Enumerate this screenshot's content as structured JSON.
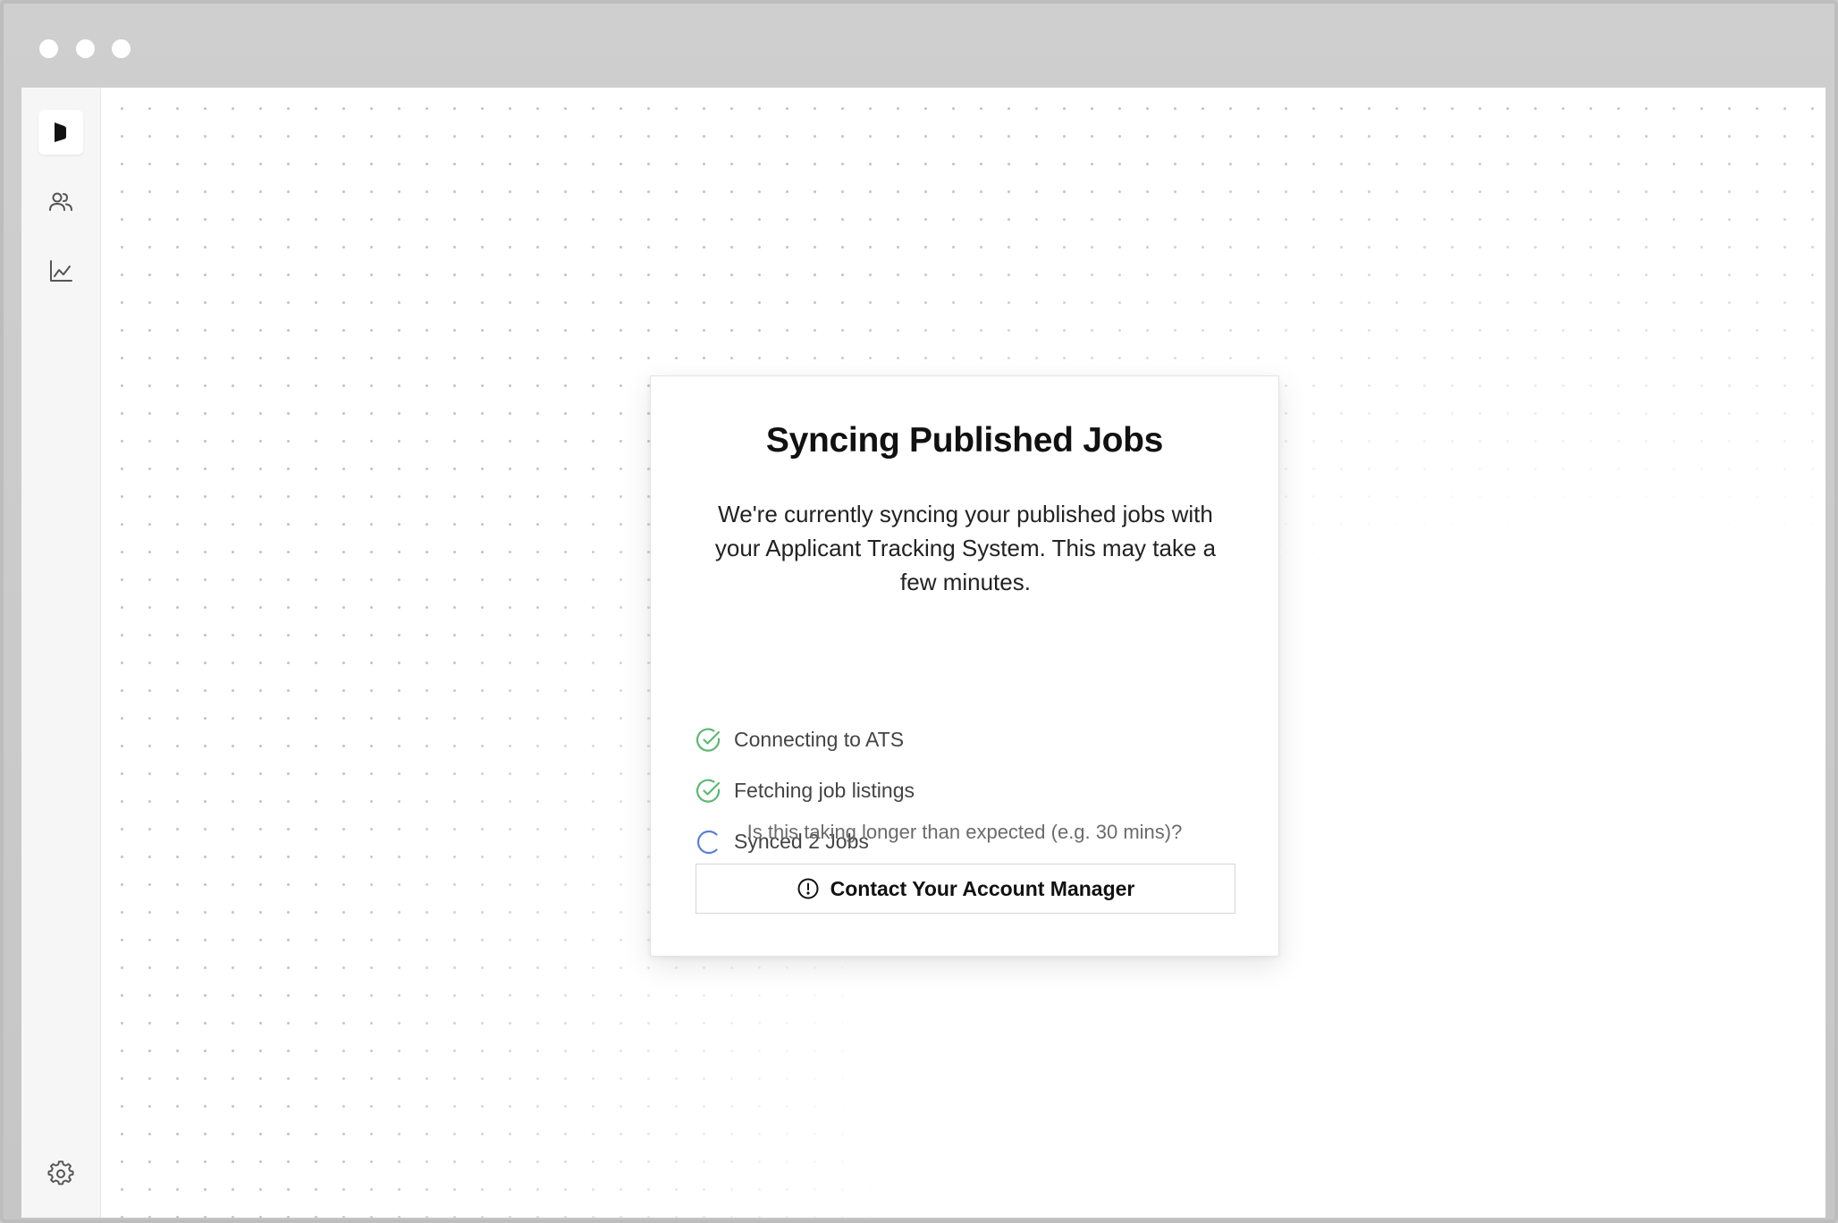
{
  "window": {
    "controls": [
      "close",
      "minimize",
      "zoom"
    ]
  },
  "sidebar": {
    "items": [
      {
        "id": "logo",
        "icon": "logo-icon"
      },
      {
        "id": "people",
        "icon": "users-icon"
      },
      {
        "id": "analytics",
        "icon": "chart-line-icon"
      }
    ],
    "footer_icon": "settings-gear-icon"
  },
  "sync_card": {
    "title": "Syncing Published Jobs",
    "description": "We're currently syncing your published jobs with your Applicant Tracking System. This may take a few minutes.",
    "steps": [
      {
        "label": "Connecting to ATS",
        "status": "complete"
      },
      {
        "label": "Fetching job listings",
        "status": "complete"
      },
      {
        "label": "Synced 2 Jobs",
        "status": "in-progress"
      }
    ],
    "hint": "Is this taking longer than expected (e.g. 30 mins)?",
    "contact_button": "Contact Your Account Manager"
  },
  "colors": {
    "success": "#5cb872",
    "progress": "#5b7fd6",
    "text_primary": "#111111"
  }
}
